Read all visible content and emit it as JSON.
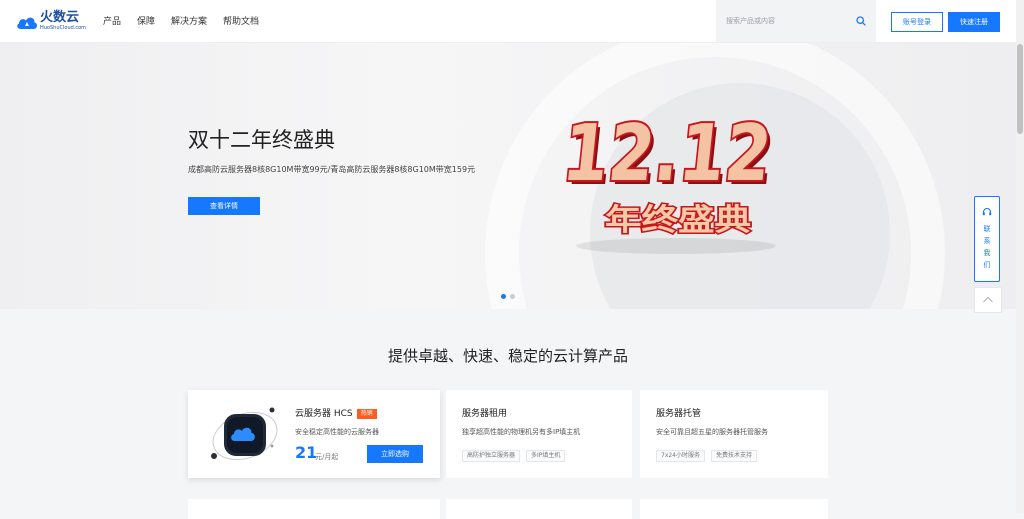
{
  "header": {
    "logo_main": "火数云",
    "logo_sub": "HuoShuCloud.com",
    "nav": [
      "产品",
      "保障",
      "解决方案",
      "帮助文档"
    ],
    "search_placeholder": "搜索产品或内容",
    "login_label": "账号登录",
    "register_label": "快速注册"
  },
  "banner": {
    "title": "双十二年终盛典",
    "subtitle": "成都高防云服务器8核8G10M带宽99元/青岛高防云服务器8核8G10M带宽159元",
    "button_label": "查看详情",
    "promo_number": "12.12",
    "promo_text": "年终盛典",
    "slides": 2,
    "active_slide": 0
  },
  "side": {
    "contact_chars": [
      "联",
      "系",
      "我",
      "们"
    ]
  },
  "section": {
    "title": "提供卓越、快速、稳定的云计算产品"
  },
  "products": [
    {
      "name": "云服务器 HCS",
      "badge": "热销",
      "desc": "安全稳定高性能的云服务器",
      "price": "21",
      "price_unit": "元/月起",
      "buy_label": "立即选购"
    },
    {
      "name": "服务器租用",
      "desc": "独享超高性能的物理机另有多IP填主机",
      "tags": [
        "高防护独立服务器",
        "多IP填主机"
      ]
    },
    {
      "name": "服务器托管",
      "desc": "安全可靠且超五星的服务器托管服务",
      "tags": [
        "7x24小时服务",
        "免费技术支持"
      ]
    }
  ],
  "colors": {
    "accent": "#1677ff",
    "badge": "#ff5a1f",
    "promo_red": "#c8161d"
  }
}
